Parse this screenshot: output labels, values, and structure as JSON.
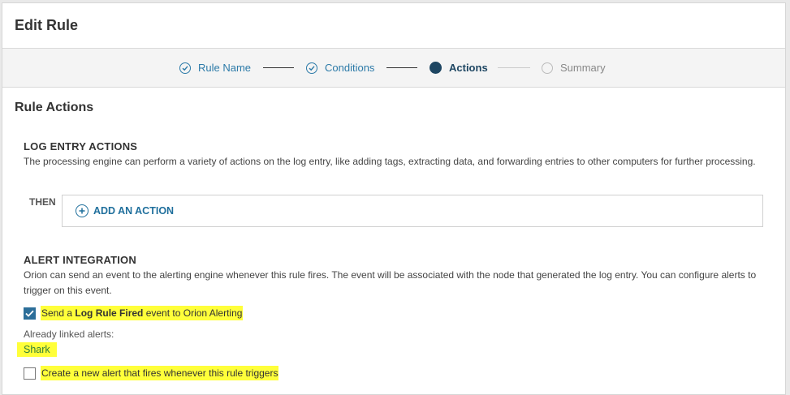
{
  "header": {
    "title": "Edit Rule"
  },
  "wizard": {
    "steps": [
      {
        "label": "Rule Name",
        "state": "done"
      },
      {
        "label": "Conditions",
        "state": "done"
      },
      {
        "label": "Actions",
        "state": "active"
      },
      {
        "label": "Summary",
        "state": "todo"
      }
    ]
  },
  "rule_actions": {
    "title": "Rule Actions",
    "log_entry": {
      "heading": "LOG ENTRY ACTIONS",
      "description": "The processing engine can perform a variety of actions on the log entry, like adding tags, extracting data, and forwarding entries to other computers for further processing.",
      "then_label": "THEN",
      "add_action_label": "ADD AN ACTION"
    },
    "alert": {
      "heading": "ALERT INTEGRATION",
      "description": "Orion can send an event to the alerting engine whenever this rule fires. The event will be associated with the node that generated the log entry. You can configure alerts to trigger on this event.",
      "send_event": {
        "checked": true,
        "prefix": "Send a ",
        "bold": "Log Rule Fired",
        "suffix": " event to Orion Alerting"
      },
      "linked_label": "Already linked alerts:",
      "linked_alerts": [
        "Shark"
      ],
      "create_new": {
        "checked": false,
        "label": "Create a new alert that fires whenever this rule triggers"
      }
    }
  },
  "colors": {
    "accent": "#2c7aa8",
    "active_step": "#1e4662",
    "highlight": "#ffff3a",
    "link_green": "#2f7d3a"
  }
}
